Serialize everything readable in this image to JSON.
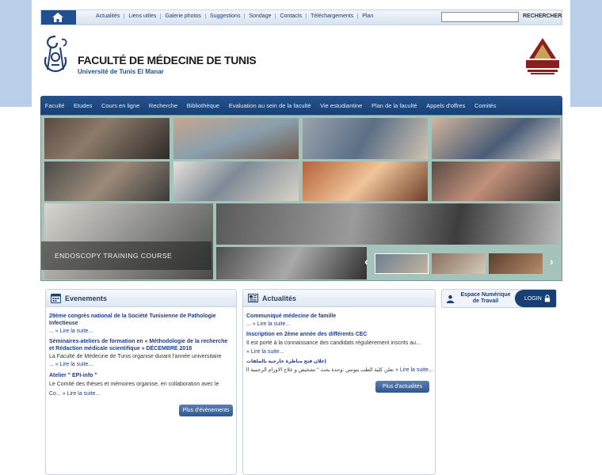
{
  "topbar": {
    "links": [
      "Actualités",
      "Liens utiles",
      "Galerie photos",
      "Suggestions",
      "Sondage",
      "Contacts",
      "Téléchargements",
      "Plan"
    ],
    "search_placeholder": "",
    "search_button": "RECHERCHER"
  },
  "header": {
    "title": "FACULTÉ DE MÉDECINE DE TUNIS",
    "subtitle": "Université de Tunis El Manar"
  },
  "mainnav": [
    "Faculté",
    "Etudes",
    "Cours en ligne",
    "Recherche",
    "Bibliothèque",
    "Evaluation au sein de la faculté",
    "Vie estudiantine",
    "Plan de la faculté",
    "Appels d'offres",
    "Comités"
  ],
  "slider": {
    "caption": "ENDOSCOPY TRAINING COURSE",
    "prev_icon": "‹",
    "next_icon": "›"
  },
  "events": {
    "title": "Evenements",
    "items": [
      {
        "title": "29ème congrès national de la Société Tunisienne de Pathologie Infectieuse",
        "text": "",
        "more": "... » Lire la suite..."
      },
      {
        "title": "Séminaires-ateliers de formation en « Méthodologie de la recherche et Rédaction médicale scientifique » DÉCEMBRE 2018",
        "text": "La Faculté de Médecine de Tunis organise durant l'année universitaire",
        "more": "... » Lire la suite..."
      },
      {
        "title": "Atelier \" EPI-info \"",
        "text": "Le Comité des thèses et mémoires organise, en collaboration avec le",
        "more": "Co... » Lire la suite..."
      }
    ],
    "button": "Plus d'évènements"
  },
  "news": {
    "title": "Actualités",
    "items": [
      {
        "title": "Communiqué médecine de famille",
        "text": "",
        "more": "... » Lire la suite..."
      },
      {
        "title": "Inscription en 2ème année des différents CEC",
        "text": "Il est porté à la connaissance des candidats régulièrement inscrits au...",
        "more": "» Lire la suite..."
      },
      {
        "title": "إعلان فتح مناظرة خارجية بالملفات",
        "text": "تعلن كلية الطب بتونس :وحدة بحث \" تشخيص و علاج الأورام الرحمية الحميدة",
        "more": "» Lire la suite..."
      }
    ],
    "button": "Plus d'actualités"
  },
  "ent": {
    "label": "Espace Numérique de Travail",
    "login": "LOGIN"
  },
  "colors": {
    "nav": "#1f4f8f",
    "band": "#b9cfe9",
    "link": "#1a3d8f"
  }
}
